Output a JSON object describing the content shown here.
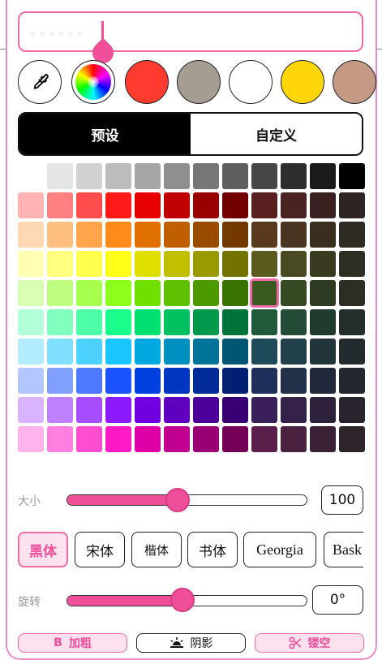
{
  "text_input": {
    "value": "- - - - - -"
  },
  "swatches": [
    {
      "name": "eyedropper",
      "icon": "eyedropper-icon"
    },
    {
      "name": "color-wheel",
      "icon": "color-wheel"
    },
    {
      "name": "red",
      "color": "#ff3b30"
    },
    {
      "name": "taupe",
      "color": "#a69d92"
    },
    {
      "name": "white",
      "color": "#ffffff"
    },
    {
      "name": "yellow",
      "color": "#ffd60a"
    },
    {
      "name": "tan",
      "color": "#c49a85"
    }
  ],
  "tabs": {
    "preset": "预设",
    "custom": "自定义",
    "active": "preset"
  },
  "palette": {
    "selected": [
      4,
      8
    ],
    "rows": [
      [
        "#ffffff",
        "#e5e5e5",
        "#d1d1d1",
        "#bcbcbc",
        "#a6a6a6",
        "#8f8f8f",
        "#777777",
        "#5e5e5e",
        "#464646",
        "#2e2e2e",
        "#1a1a1a",
        "#000000"
      ],
      [
        "#ffb3b3",
        "#ff8080",
        "#ff4d4d",
        "#ff1a1a",
        "#e60000",
        "#c00000",
        "#990000",
        "#730000",
        "#5a1f1f",
        "#4a2222",
        "#3a2121",
        "#2e2424"
      ],
      [
        "#ffd9b3",
        "#ffbf80",
        "#ffa64d",
        "#ff8c1a",
        "#e07000",
        "#c05f00",
        "#994c00",
        "#733900",
        "#5a3a1f",
        "#4a3522",
        "#3a2e21",
        "#2e2a24"
      ],
      [
        "#ffffb3",
        "#ffff80",
        "#ffff4d",
        "#ffff1a",
        "#e0e000",
        "#c0c000",
        "#999900",
        "#737300",
        "#5a5a1f",
        "#4a4a22",
        "#3a3a21",
        "#2e2e24"
      ],
      [
        "#d9ffb3",
        "#bfff80",
        "#a6ff4d",
        "#8cff1a",
        "#70e000",
        "#5fc000",
        "#4c9900",
        "#397300",
        "#3a5a1f",
        "#354a22",
        "#2e3a21",
        "#2a2e24"
      ],
      [
        "#b3ffd9",
        "#80ffbf",
        "#4dffa6",
        "#1aff8c",
        "#00e070",
        "#00c05f",
        "#00994c",
        "#007339",
        "#1f5a3a",
        "#224a35",
        "#213a2e",
        "#242e2a"
      ],
      [
        "#b3ecff",
        "#80dfff",
        "#4dd2ff",
        "#1ac6ff",
        "#00a8e0",
        "#0090c0",
        "#007399",
        "#005673",
        "#1f4a5a",
        "#22404a",
        "#21353a",
        "#242b2e"
      ],
      [
        "#b3c6ff",
        "#809fff",
        "#4d79ff",
        "#1a53ff",
        "#0040e0",
        "#0036c0",
        "#002b99",
        "#002073",
        "#1f2f5a",
        "#22304a",
        "#21283a",
        "#24272e"
      ],
      [
        "#d9b3ff",
        "#bf80ff",
        "#a64dff",
        "#8c1aff",
        "#7000e0",
        "#5f00c0",
        "#4c0099",
        "#390073",
        "#3a1f5a",
        "#35224a",
        "#2e213a",
        "#2a242e"
      ],
      [
        "#ffb3ec",
        "#ff80df",
        "#ff4dd2",
        "#ff1ac6",
        "#e000a8",
        "#c00090",
        "#990073",
        "#730056",
        "#5a1f4a",
        "#4a2240",
        "#3a2135",
        "#2e242b"
      ]
    ]
  },
  "size": {
    "label": "大小",
    "value": "100",
    "level": 0.46
  },
  "fonts": [
    {
      "label": "黑体",
      "active": true
    },
    {
      "label": "宋体",
      "active": false
    },
    {
      "label": "楷体",
      "active": false
    },
    {
      "label": "书体",
      "active": false
    },
    {
      "label": "Georgia",
      "active": false
    },
    {
      "label": "Bask",
      "active": false
    }
  ],
  "rotation": {
    "label": "旋转",
    "value": "0°",
    "level": 0.48
  },
  "actions": {
    "bold": {
      "icon_text": "B",
      "label": "加粗"
    },
    "shadow": {
      "icon": "sunset-icon",
      "label": "阴影"
    },
    "hollow": {
      "icon": "scissors-icon",
      "label": "镂空"
    }
  },
  "colors": {
    "accent": "#ef4e99",
    "accent_light": "#fde1ef",
    "border": "#f28ac6"
  }
}
